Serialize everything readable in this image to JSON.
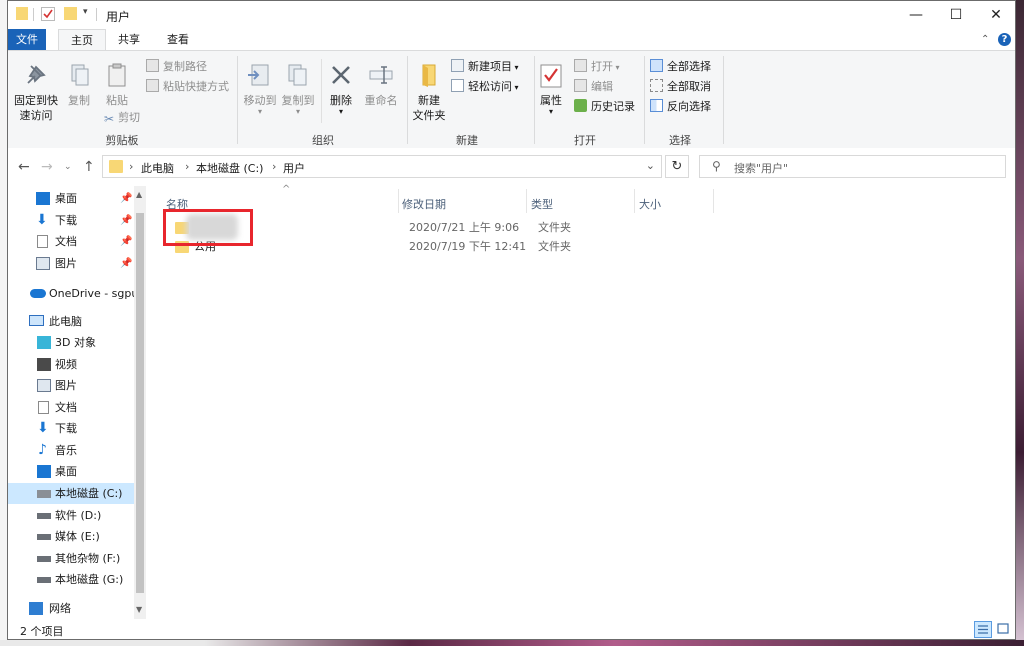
{
  "window": {
    "title": "用户",
    "controls": {
      "minimize": "—",
      "maximize": "☐",
      "close": "✕"
    }
  },
  "tabs": [
    {
      "label": "文件"
    },
    {
      "label": "主页"
    },
    {
      "label": "共享"
    },
    {
      "label": "查看"
    }
  ],
  "ribbon": {
    "clipboard": {
      "pin_label_1": "固定到快",
      "pin_label_2": "速访问",
      "copy": "复制",
      "paste": "粘贴",
      "copy_path": "复制路径",
      "paste_shortcut": "粘贴快捷方式",
      "cut": "剪切",
      "group": "剪贴板"
    },
    "organize": {
      "move_to": "移动到",
      "copy_to": "复制到",
      "delete": "删除",
      "rename": "重命名",
      "group": "组织"
    },
    "new": {
      "new_folder_1": "新建",
      "new_folder_2": "文件夹",
      "new_item": "新建项目",
      "easy_access": "轻松访问",
      "group": "新建"
    },
    "open": {
      "properties": "属性",
      "open": "打开",
      "edit": "编辑",
      "history": "历史记录",
      "group": "打开"
    },
    "select": {
      "select_all": "全部选择",
      "select_none": "全部取消",
      "invert": "反向选择",
      "group": "选择"
    }
  },
  "address": {
    "crumbs": [
      "此电脑",
      "本地磁盘 (C:)",
      "用户"
    ],
    "search_placeholder": "搜索\"用户\""
  },
  "sidebar": {
    "quick_access": [
      {
        "label": "桌面"
      },
      {
        "label": "下载"
      },
      {
        "label": "文档"
      },
      {
        "label": "图片"
      }
    ],
    "onedrive": "OneDrive - sgpu",
    "this_pc": "此电脑",
    "pc_items": [
      {
        "label": "3D 对象"
      },
      {
        "label": "视频"
      },
      {
        "label": "图片"
      },
      {
        "label": "文档"
      },
      {
        "label": "下载"
      },
      {
        "label": "音乐"
      },
      {
        "label": "桌面"
      },
      {
        "label": "本地磁盘 (C:)"
      },
      {
        "label": "软件 (D:)"
      },
      {
        "label": "媒体 (E:)"
      },
      {
        "label": "其他杂物 (F:)"
      },
      {
        "label": "本地磁盘 (G:)"
      }
    ],
    "network": "网络"
  },
  "columns": {
    "name": "名称",
    "modified": "修改日期",
    "type": "类型",
    "size": "大小"
  },
  "files": [
    {
      "name": "",
      "modified": "2020/7/21 上午 9:06",
      "type": "文件夹"
    },
    {
      "name": "公用",
      "modified": "2020/7/19 下午 12:41",
      "type": "文件夹"
    }
  ],
  "status": {
    "count": "2 个项目"
  },
  "colors": {
    "accent": "#1a63b8",
    "selected": "#cce8ff",
    "folder": "#f8d775",
    "highlight": "#e8262d"
  }
}
